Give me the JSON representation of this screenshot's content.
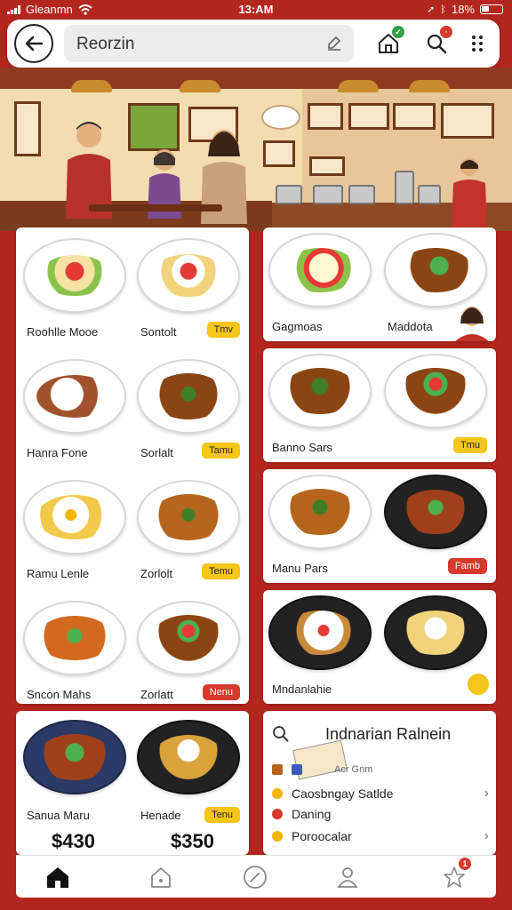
{
  "status": {
    "carrier": "Gleanmn",
    "time": "13:AM",
    "battery": "18%"
  },
  "topbar": {
    "search_value": "Reorzin",
    "cart_badge": "",
    "search_badge": ""
  },
  "scene": {
    "label": "restaurant-illustration"
  },
  "left_grid": {
    "items": [
      {
        "label": "Roohlle Mooe",
        "tag": ""
      },
      {
        "label": "Sontolt",
        "tag": "Tmv"
      },
      {
        "label": "Hanra Fone",
        "tag": ""
      },
      {
        "label": "Sorlalt",
        "tag": "Tamu"
      },
      {
        "label": "Ramu Lenle",
        "tag": ""
      },
      {
        "label": "Zorlolt",
        "tag": "Temu"
      },
      {
        "label": "Sncon Mahs",
        "tag": ""
      },
      {
        "label": "Zorlatt",
        "tag": "Nenu"
      }
    ]
  },
  "right_grid": {
    "items": [
      {
        "label": "Gagmoas",
        "tag": ""
      },
      {
        "label": "Maddota",
        "tag": ""
      },
      {
        "label": "Banno Sars",
        "tag": "Tmu"
      },
      {
        "label": "Manu Pars",
        "tag": "Famb"
      },
      {
        "label": "Mndanlahie",
        "tag": ""
      }
    ]
  },
  "bottom_left": {
    "items": [
      {
        "label": "Sanua Maru",
        "price": "$430"
      },
      {
        "label": "Henade",
        "tag": "Tenu",
        "price": "$350"
      }
    ]
  },
  "info": {
    "title": "Indnarian Ralnein",
    "subtitle": "Acr Gnm",
    "rows": [
      {
        "label": "Caosbngay Satlde"
      },
      {
        "label": "Daning"
      },
      {
        "label": "Poroocalar"
      }
    ]
  },
  "nav": {
    "badge": "1"
  },
  "colors": {
    "brand_red": "#b3261e",
    "tag_yellow": "#f5c518",
    "tag_red": "#d63a2c"
  }
}
